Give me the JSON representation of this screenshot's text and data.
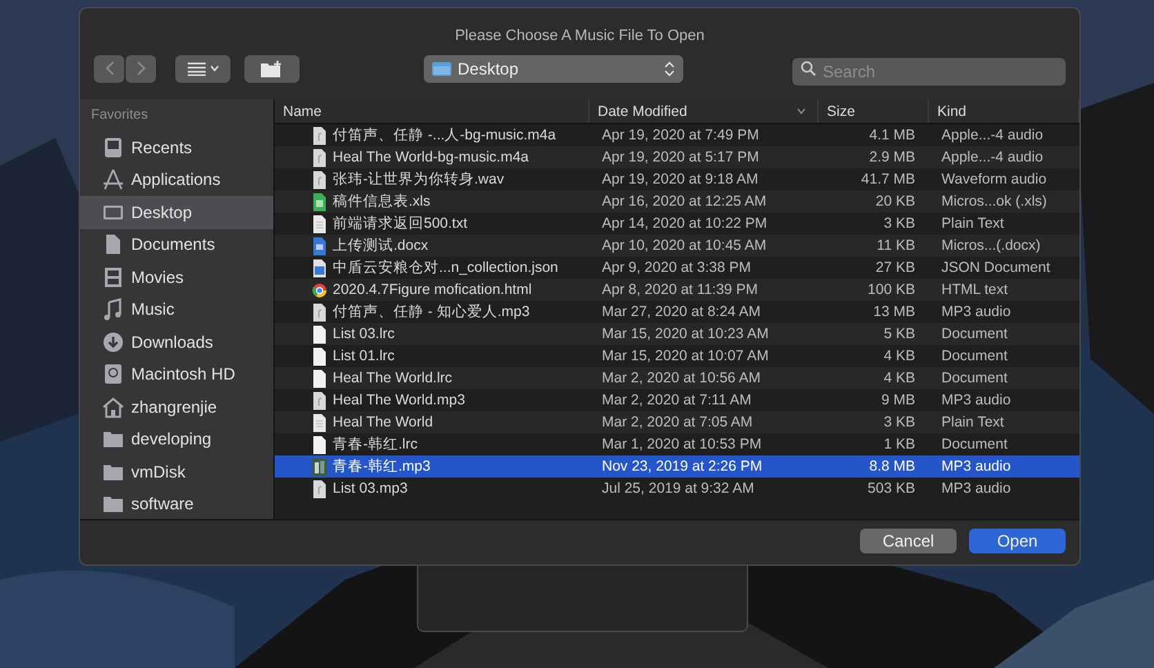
{
  "window": {
    "title": "Please Choose A Music File To Open"
  },
  "toolbar": {
    "location": "Desktop",
    "search": {
      "placeholder": "Search"
    }
  },
  "sidebar": {
    "heading": "Favorites",
    "items": [
      {
        "label": "Recents",
        "kind": "recents",
        "selected": false
      },
      {
        "label": "Applications",
        "kind": "apps",
        "selected": false
      },
      {
        "label": "Desktop",
        "kind": "desktop",
        "selected": true
      },
      {
        "label": "Documents",
        "kind": "documents",
        "selected": false
      },
      {
        "label": "Movies",
        "kind": "movies",
        "selected": false
      },
      {
        "label": "Music",
        "kind": "music",
        "selected": false
      },
      {
        "label": "Downloads",
        "kind": "downloads",
        "selected": false
      },
      {
        "label": "Macintosh HD",
        "kind": "disk",
        "selected": false
      },
      {
        "label": "zhangrenjie",
        "kind": "home",
        "selected": false
      },
      {
        "label": "developing",
        "kind": "folder",
        "selected": false
      },
      {
        "label": "vmDisk",
        "kind": "folder",
        "selected": false
      },
      {
        "label": "software",
        "kind": "folder",
        "selected": false
      }
    ]
  },
  "table": {
    "columns": [
      "Name",
      "Date Modified",
      "Size",
      "Kind"
    ],
    "rows": [
      {
        "name": "付笛声、任静 -...人-bg-music.m4a",
        "date": "Apr 19, 2020 at 7:49 PM",
        "size": "4.1 MB",
        "kind_text": "Apple...-4 audio",
        "kind": "audio",
        "selected": false
      },
      {
        "name": "Heal The World-bg-music.m4a",
        "date": "Apr 19, 2020 at 5:17 PM",
        "size": "2.9 MB",
        "kind_text": "Apple...-4 audio",
        "kind": "audio",
        "selected": false
      },
      {
        "name": "张玮-让世界为你转身.wav",
        "date": "Apr 19, 2020 at 9:18 AM",
        "size": "41.7 MB",
        "kind_text": "Waveform audio",
        "kind": "audio",
        "selected": false
      },
      {
        "name": "稿件信息表.xls",
        "date": "Apr 16, 2020 at 12:25 AM",
        "size": "20 KB",
        "kind_text": "Micros...ok (.xls)",
        "kind": "sheet",
        "selected": false
      },
      {
        "name": "前端请求返回500.txt",
        "date": "Apr 14, 2020 at 10:22 PM",
        "size": "3 KB",
        "kind_text": "Plain Text",
        "kind": "text",
        "selected": false
      },
      {
        "name": "上传测试.docx",
        "date": "Apr 10, 2020 at 10:45 AM",
        "size": "11 KB",
        "kind_text": "Micros...(.docx)",
        "kind": "word",
        "selected": false
      },
      {
        "name": "中盾云安粮仓对...n_collection.json",
        "date": "Apr 9, 2020 at 3:38 PM",
        "size": "27 KB",
        "kind_text": "JSON Document",
        "kind": "json",
        "selected": false
      },
      {
        "name": "2020.4.7Figure mofication.html",
        "date": "Apr 8, 2020 at 11:39 PM",
        "size": "100 KB",
        "kind_text": "HTML text",
        "kind": "html",
        "selected": false
      },
      {
        "name": "付笛声、任静 - 知心爱人.mp3",
        "date": "Mar 27, 2020 at 8:24 AM",
        "size": "13 MB",
        "kind_text": "MP3 audio",
        "kind": "audio",
        "selected": false
      },
      {
        "name": "List 03.lrc",
        "date": "Mar 15, 2020 at 10:23 AM",
        "size": "5 KB",
        "kind_text": "Document",
        "kind": "blank",
        "selected": false
      },
      {
        "name": "List 01.lrc",
        "date": "Mar 15, 2020 at 10:07 AM",
        "size": "4 KB",
        "kind_text": "Document",
        "kind": "blank",
        "selected": false
      },
      {
        "name": "Heal The World.lrc",
        "date": "Mar 2, 2020 at 10:56 AM",
        "size": "4 KB",
        "kind_text": "Document",
        "kind": "blank",
        "selected": false
      },
      {
        "name": "Heal The World.mp3",
        "date": "Mar 2, 2020 at 7:11 AM",
        "size": "9 MB",
        "kind_text": "MP3 audio",
        "kind": "audio",
        "selected": false
      },
      {
        "name": "Heal The World",
        "date": "Mar 2, 2020 at 7:05 AM",
        "size": "3 KB",
        "kind_text": "Plain Text",
        "kind": "text",
        "selected": false
      },
      {
        "name": "青春-韩红.lrc",
        "date": "Mar 1, 2020 at 10:53 PM",
        "size": "1 KB",
        "kind_text": "Document",
        "kind": "blank",
        "selected": false
      },
      {
        "name": "青春-韩红.mp3",
        "date": "Nov 23, 2019 at 2:26 PM",
        "size": "8.8 MB",
        "kind_text": "MP3 audio",
        "kind": "album",
        "selected": true
      },
      {
        "name": "List 03.mp3",
        "date": "Jul 25, 2019 at 9:32 AM",
        "size": "503 KB",
        "kind_text": "MP3 audio",
        "kind": "audio",
        "selected": false
      }
    ]
  },
  "buttons": [
    {
      "label": "Cancel",
      "kind": "secondary"
    },
    {
      "label": "Open",
      "kind": "primary"
    }
  ]
}
